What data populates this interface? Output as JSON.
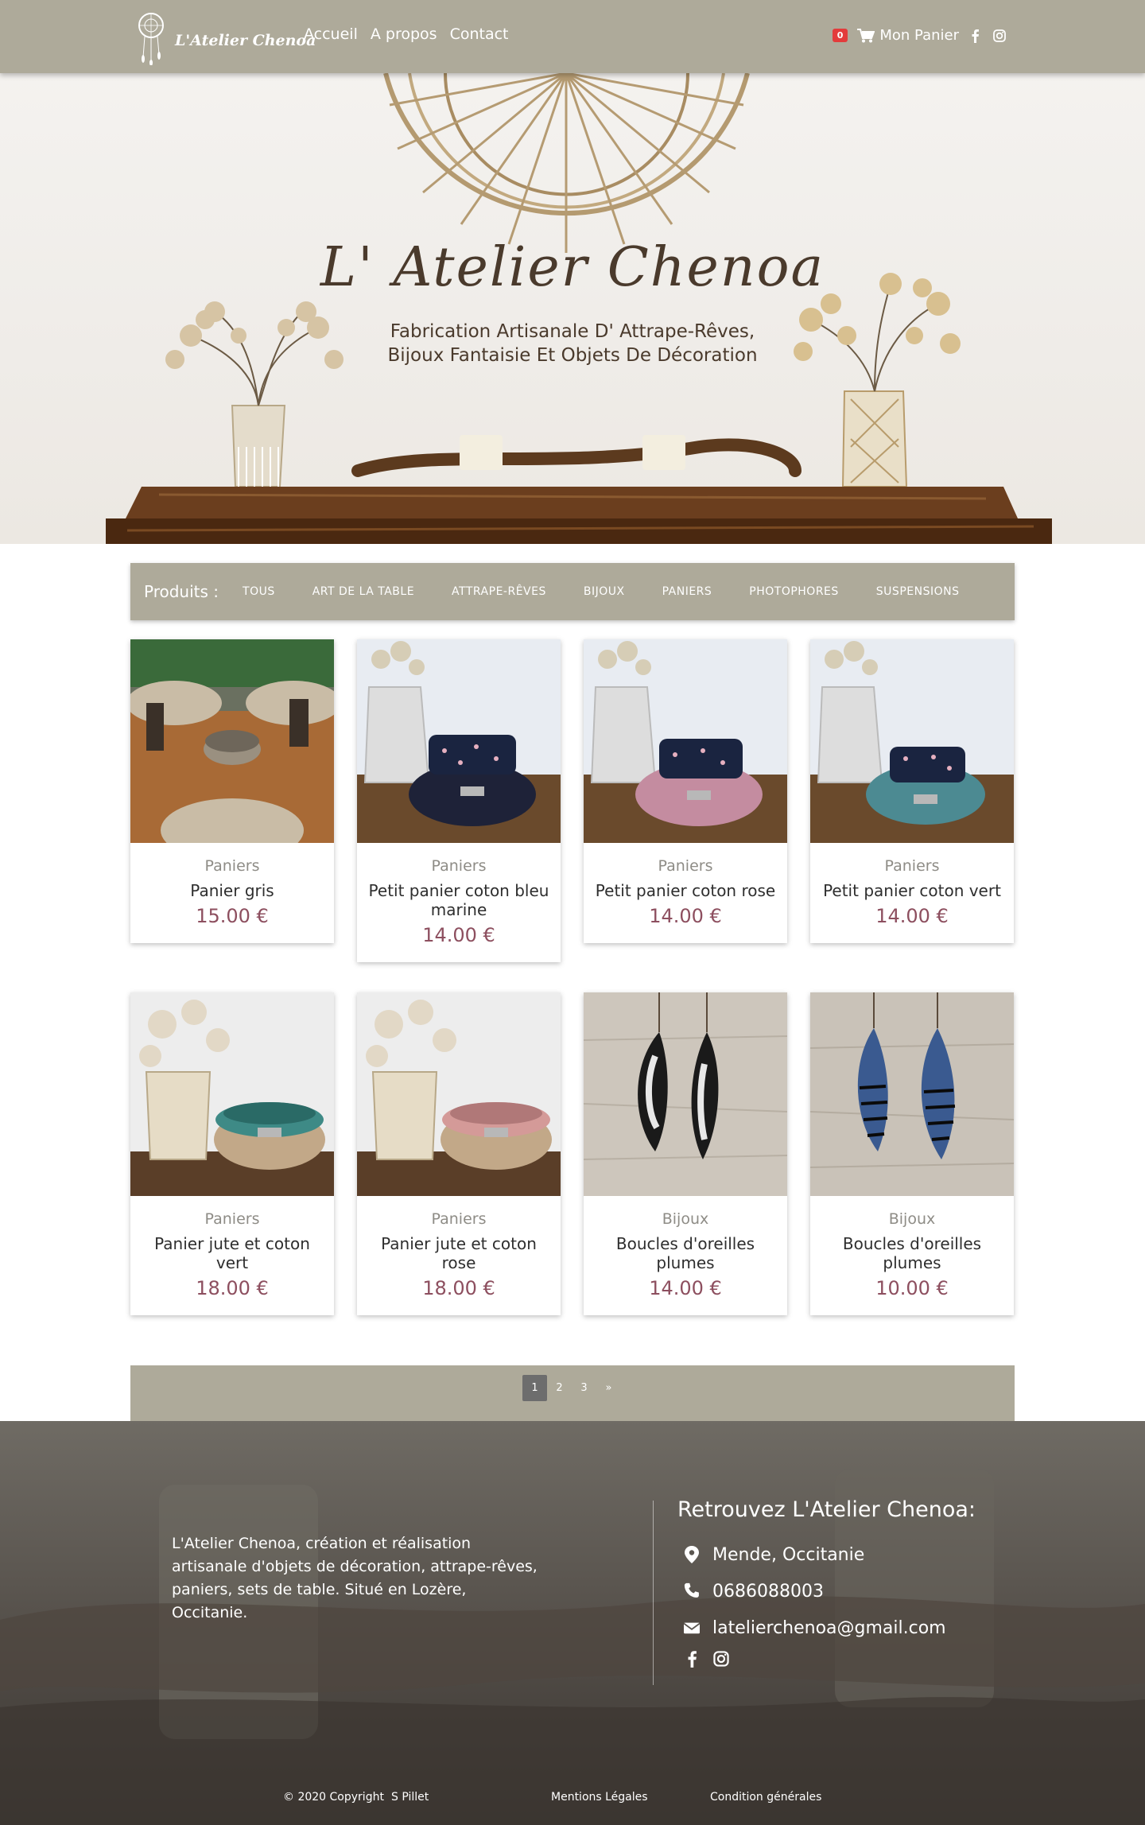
{
  "nav": {
    "brand": "L'Atelier Chenoa",
    "links": [
      "Accueil",
      "A propos",
      "Contact"
    ],
    "cart_count": "0",
    "cart_label": "Mon Panier"
  },
  "hero": {
    "title": "L' Atelier Chenoa",
    "subtitle_line1": "Fabrication Artisanale D' Attrape-Rêves,",
    "subtitle_line2": "Bijoux Fantaisie Et Objets De Décoration"
  },
  "categories": {
    "title": "Produits :",
    "items": [
      "TOUS",
      "ART DE LA TABLE",
      "ATTRAPE-RÊVES",
      "BIJOUX",
      "PANIERS",
      "PHOTOPHORES",
      "SUSPENSIONS"
    ]
  },
  "products": [
    {
      "category": "Paniers",
      "name": "Panier gris",
      "price": "15.00 €"
    },
    {
      "category": "Paniers",
      "name": "Petit panier coton bleu marine",
      "price": "14.00 €"
    },
    {
      "category": "Paniers",
      "name": "Petit panier coton rose",
      "price": "14.00 €"
    },
    {
      "category": "Paniers",
      "name": "Petit panier coton vert",
      "price": "14.00 €"
    },
    {
      "category": "Paniers",
      "name": "Panier jute et coton vert",
      "price": "18.00 €"
    },
    {
      "category": "Paniers",
      "name": "Panier jute et coton rose",
      "price": "18.00 €"
    },
    {
      "category": "Bijoux",
      "name": "Boucles d'oreilles plumes",
      "price": "14.00 €"
    },
    {
      "category": "Bijoux",
      "name": "Boucles d'oreilles plumes",
      "price": "10.00 €"
    }
  ],
  "pagination": {
    "pages": [
      "1",
      "2",
      "3",
      "»"
    ],
    "active": "1"
  },
  "footer": {
    "about": "L'Atelier Chenoa, création et réalisation artisanale d'objets de décoration, attrape-rêves, paniers, sets de table. Situé en Lozère, Occitanie.",
    "contact_title": "Retrouvez L'Atelier Chenoa:",
    "location": "Mende, Occitanie",
    "phone": "0686088003",
    "email": "latelierchenoa@gmail.com",
    "copyright": "© 2020 Copyright",
    "author": "S Pillet",
    "legal": "Mentions Légales",
    "terms": "Condition générales"
  }
}
